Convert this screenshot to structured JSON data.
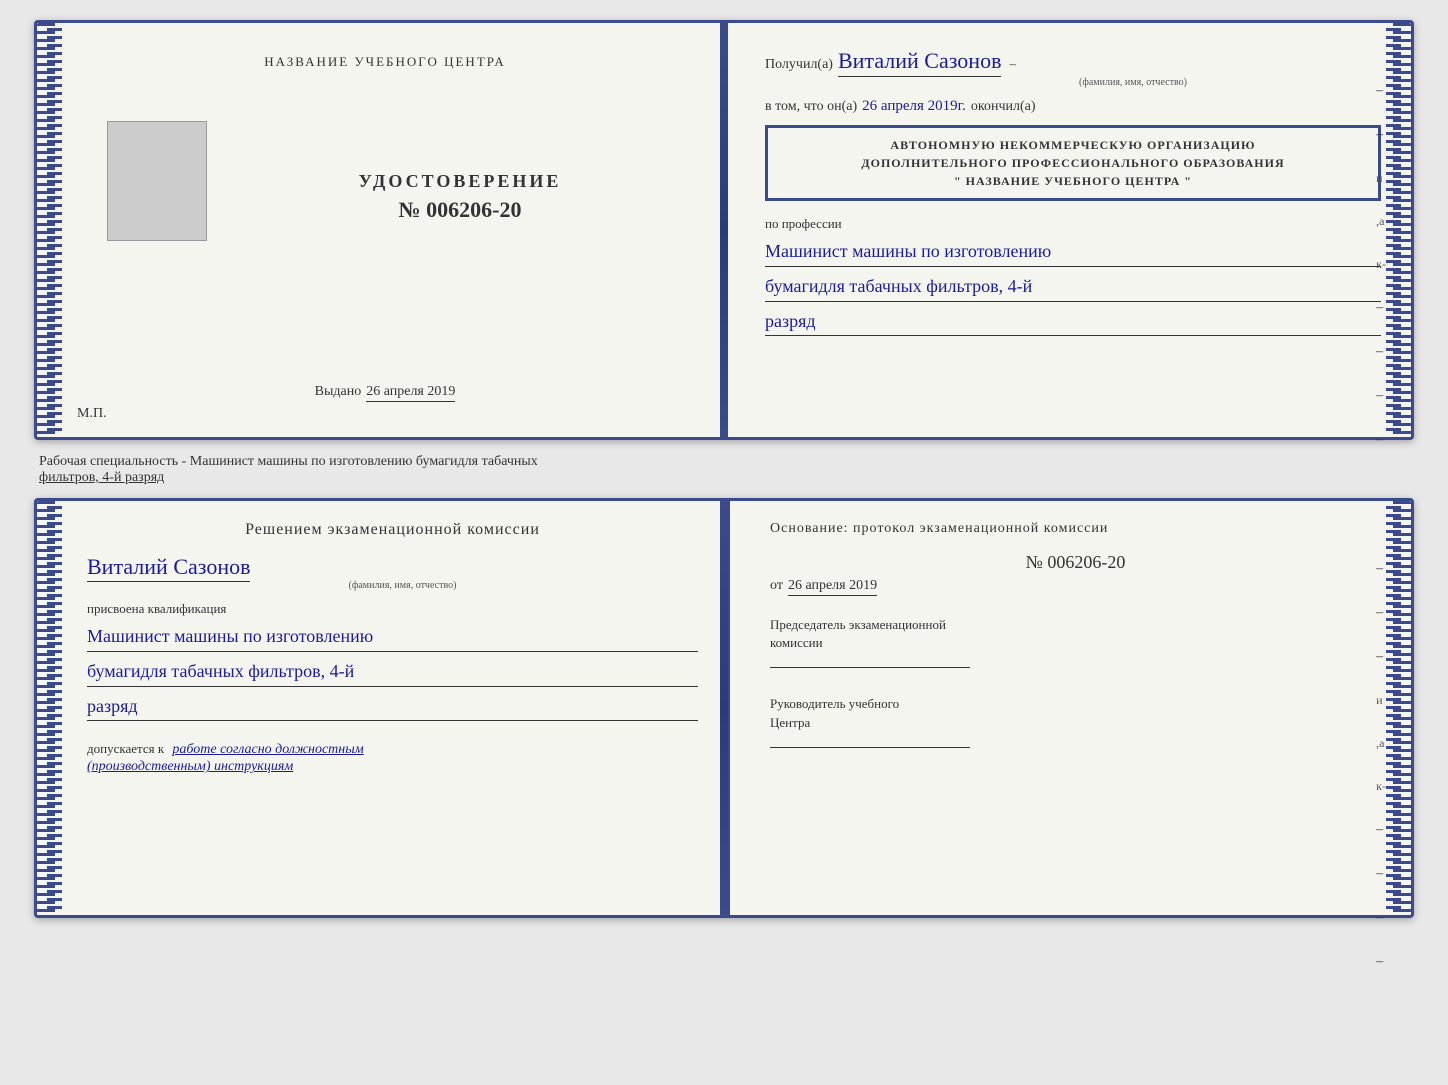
{
  "document": {
    "top": {
      "left": {
        "training_center_label": "НАЗВАНИЕ УЧЕБНОГО ЦЕНТРА",
        "certificate_title": "УДОСТОВЕРЕНИЕ",
        "certificate_number": "№ 006206-20",
        "issued_label": "Выдано",
        "issued_date": "26 апреля 2019",
        "mp_label": "М.П."
      },
      "right": {
        "received_label": "Получил(а)",
        "recipient_name": "Виталий Сазонов",
        "fio_hint": "(фамилия, имя, отчество)",
        "in_that_label": "в том, что он(а)",
        "date_label": "26 апреля 2019г.",
        "finished_label": "окончил(а)",
        "stamp_line1": "АВТОНОМНУЮ НЕКОММЕРЧЕСКУЮ ОРГАНИЗАЦИЮ",
        "stamp_line2": "ДОПОЛНИТЕЛЬНОГО ПРОФЕССИОНАЛЬНОГО ОБРАЗОВАНИЯ",
        "stamp_line3": "\" НАЗВАНИЕ УЧЕБНОГО ЦЕНТРА \"",
        "profession_label": "по профессии",
        "profession_handwritten_1": "Машинист машины по изготовлению",
        "profession_handwritten_2": "бумагидля табачных фильтров, 4-й",
        "profession_handwritten_3": "разряд"
      }
    },
    "separator": {
      "text_normal": "Рабочая специальность - Машинист машины по изготовлению бумагидля табачных",
      "text_underlined": "фильтров, 4-й разряд"
    },
    "bottom": {
      "left": {
        "commission_title": "Решением экзаменационной комиссии",
        "name_handwritten": "Виталий Сазонов",
        "fio_hint": "(фамилия, имя, отчество)",
        "qualification_label": "присвоена квалификация",
        "qualification_1": "Машинист машины по изготовлению",
        "qualification_2": "бумагидля табачных фильтров, 4-й",
        "qualification_3": "разряд",
        "allowed_label": "допускается к",
        "allowed_handwritten": "работе согласно должностным",
        "allowed_handwritten_2": "(производственным) инструкциям"
      },
      "right": {
        "basis_label": "Основание: протокол экзаменационной комиссии",
        "protocol_number": "№  006206-20",
        "date_from_label": "от",
        "date_from_value": "26 апреля 2019",
        "chairman_label": "Председатель экзаменационной",
        "chairman_label2": "комиссии",
        "director_label": "Руководитель учебного",
        "director_label2": "Центра"
      }
    }
  }
}
